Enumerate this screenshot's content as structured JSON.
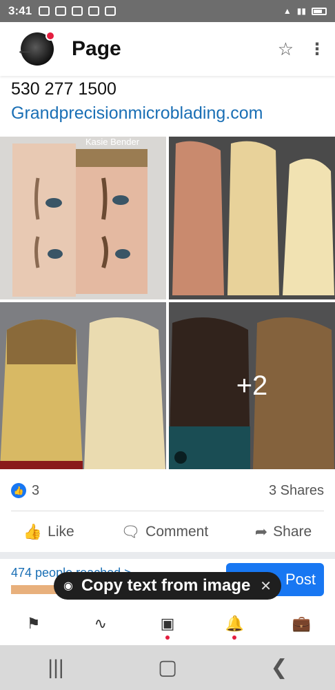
{
  "status_bar": {
    "time": "3:41"
  },
  "header": {
    "title": "Page"
  },
  "contact": {
    "phone": "530 277 1500",
    "website": "Grandprecisionmicroblading.com"
  },
  "photos": {
    "overlay_name": "Kasie Bender",
    "more_count": "+2"
  },
  "reactions": {
    "count": "3",
    "shares": "3 Shares"
  },
  "actions": {
    "like": "Like",
    "comment": "Comment",
    "share": "Share"
  },
  "reach": {
    "text": "474 people reached >",
    "bar_fraction": 0.2
  },
  "post_button": "Post",
  "toast": {
    "text": "Copy text from image"
  },
  "colors": {
    "accent": "#1877f2",
    "link": "#1a6fb5",
    "notification": "#e41e3f"
  }
}
